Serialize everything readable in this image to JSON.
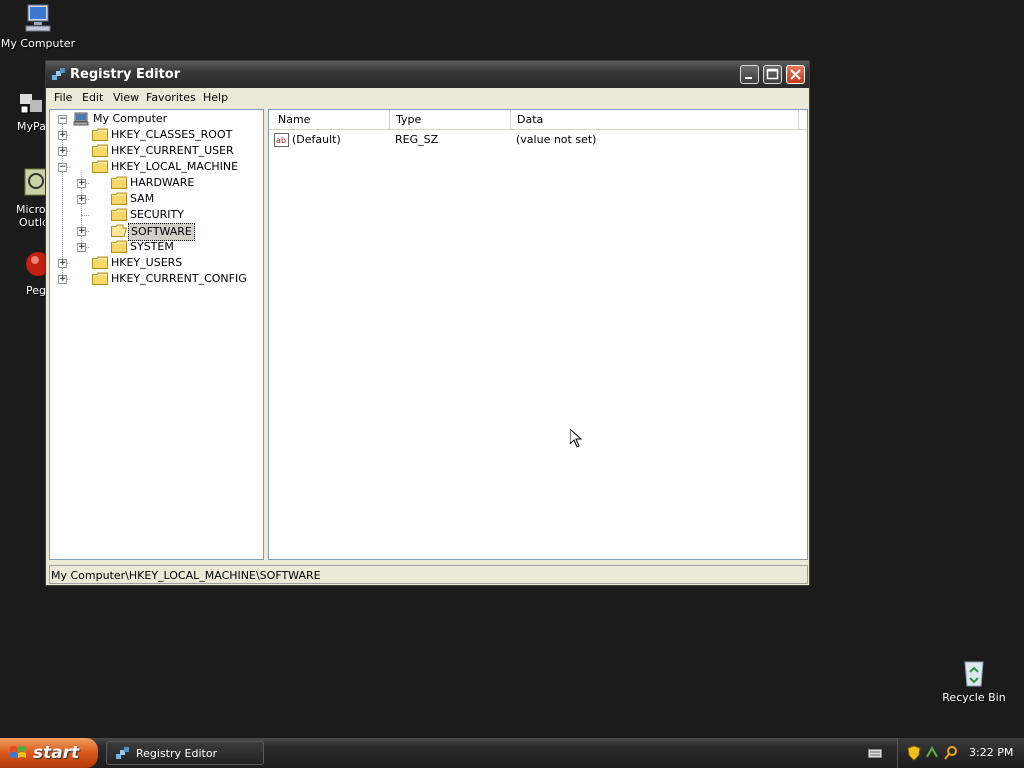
{
  "desktop": {
    "icons": [
      {
        "label": "My Computer"
      },
      {
        "label": "MyPa"
      },
      {
        "label": "Micros"
      },
      {
        "label": "Outlo"
      },
      {
        "label": "Peg"
      },
      {
        "label": "Recycle Bin"
      }
    ]
  },
  "window": {
    "title": "Registry Editor",
    "menu": [
      "File",
      "Edit",
      "View",
      "Favorites",
      "Help"
    ],
    "tree": {
      "root": "My Computer",
      "items": [
        {
          "label": "HKEY_CLASSES_ROOT",
          "expanded": false
        },
        {
          "label": "HKEY_CURRENT_USER",
          "expanded": false
        },
        {
          "label": "HKEY_LOCAL_MACHINE",
          "expanded": true
        },
        {
          "label": "HARDWARE",
          "expanded": false
        },
        {
          "label": "SAM",
          "expanded": false
        },
        {
          "label": "SECURITY",
          "expanded": null
        },
        {
          "label": "SOFTWARE",
          "expanded": false,
          "selected": true
        },
        {
          "label": "SYSTEM",
          "expanded": false
        },
        {
          "label": "HKEY_USERS",
          "expanded": false
        },
        {
          "label": "HKEY_CURRENT_CONFIG",
          "expanded": false
        }
      ]
    },
    "list": {
      "columns": [
        "Name",
        "Type",
        "Data"
      ],
      "rows": [
        {
          "icon": "ab",
          "name": "(Default)",
          "type": "REG_SZ",
          "data": "(value not set)"
        }
      ]
    },
    "status": "My Computer\\HKEY_LOCAL_MACHINE\\SOFTWARE"
  },
  "taskbar": {
    "start_label": "start",
    "task_label": "Registry Editor",
    "clock": "3:22 PM"
  },
  "colors": {
    "desktop_bg": "#1b1b1b",
    "start_orange": "#d9581a",
    "close_red": "#c23a1e"
  }
}
